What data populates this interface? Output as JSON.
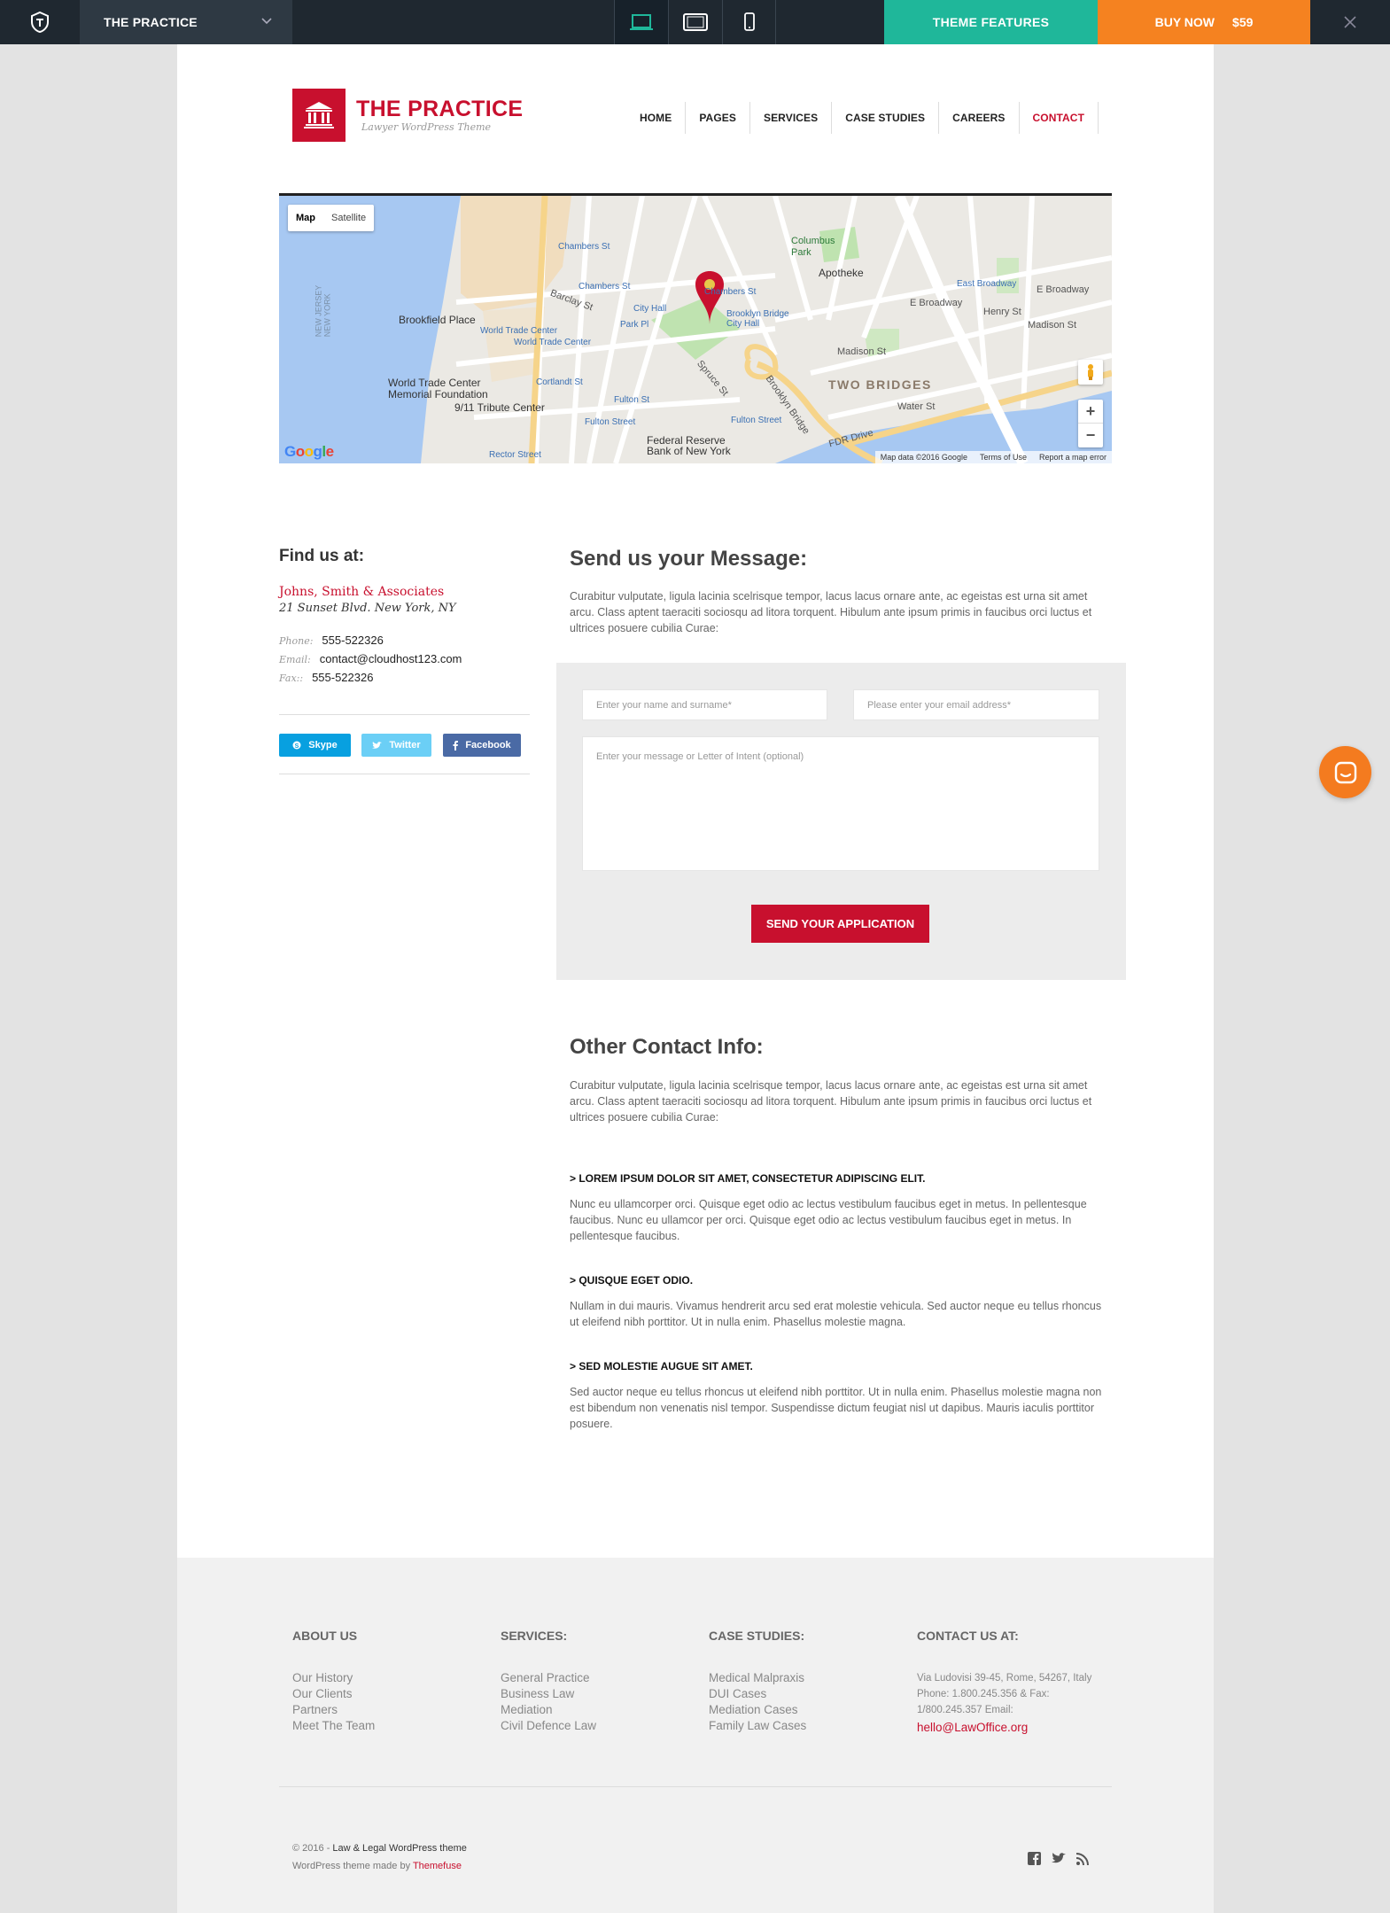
{
  "topbar": {
    "theme_name": "THE PRACTICE",
    "features_label": "THEME FEATURES",
    "buy_label": "BUY NOW",
    "price": "$59",
    "accent_features": "#1fb79a",
    "accent_buy": "#f58220"
  },
  "header": {
    "logo_title": "THE PRACTICE",
    "logo_subtitle": "Lawyer WordPress Theme",
    "nav": [
      {
        "label": "HOME"
      },
      {
        "label": "PAGES"
      },
      {
        "label": "SERVICES"
      },
      {
        "label": "CASE STUDIES"
      },
      {
        "label": "CAREERS"
      },
      {
        "label": "CONTACT",
        "active": true
      }
    ],
    "brand_color": "#c8102e"
  },
  "map": {
    "toggle_map": "Map",
    "toggle_satellite": "Satellite",
    "google": "Google",
    "footer": [
      "Map data ©2016 Google",
      "Terms of Use",
      "Report a map error"
    ],
    "labels": {
      "brookfield": "Brookfield Place",
      "wtc": "World Trade Center",
      "wtc2": "World Trade Center",
      "memorial": "World Trade Center\nMemorial Foundation",
      "tribute": "9/11 Tribute Center",
      "chambers1": "Chambers St",
      "chambers2": "Chambers St",
      "chambers3": "Chambers St",
      "cityhall": "City Hall",
      "parkpl": "Park Pl",
      "bbcityhall": "Brooklyn Bridge\nCity Hall",
      "columbus": "Columbus\nPark",
      "apotheke": "Apotheke",
      "two_bridges": "TWO BRIDGES",
      "east_broadway1": "East Broadway",
      "east_broadway2": "E Broadway",
      "e_broadway3": "E Broadway",
      "madison1": "Madison St",
      "madison2": "Madison St",
      "henry": "Henry St",
      "cortlandt": "Cortlandt St",
      "fulton1": "Fulton St",
      "fulton2": "Fulton Street",
      "fulton3": "Fulton Street",
      "fedres": "Federal Reserve\nBank of New York",
      "fdr": "FDR Drive",
      "bbridge": "Brooklyn Bridge",
      "water": "Water St",
      "rector": "Rector Street",
      "barclay": "Barclay St",
      "spruce": "Spruce St",
      "nj": "NEW JERSEY\nNEW YORK"
    }
  },
  "find_us": {
    "title": "Find us at:",
    "firm": "Johns, Smith & Associates",
    "address": "21 Sunset Blvd. New York, NY",
    "phone_label": "Phone:",
    "phone": "555-522326",
    "email_label": "Email:",
    "email": "contact@cloudhost123.com",
    "fax_label": "Fax::",
    "fax": "555-522326",
    "social": [
      {
        "label": "Skype",
        "icon": "skype-icon"
      },
      {
        "label": "Twitter",
        "icon": "twitter-icon"
      },
      {
        "label": "Facebook",
        "icon": "facebook-icon"
      }
    ]
  },
  "form": {
    "title": "Send us your Message:",
    "text": "Curabitur vulputate, ligula lacinia scelrisque tempor, lacus lacus ornare ante, ac egeistas est urna sit amet arcu. Class aptent taeraciti sociosqu ad litora torquent. Hibulum ante ipsum primis in faucibus orci luctus et ultrices posuere cubilia Curae:",
    "name_placeholder": "Enter your name and surname*",
    "email_placeholder": "Please enter your email address*",
    "message_placeholder": "Enter your message or Letter of Intent (optional)",
    "submit": "SEND YOUR APPLICATION"
  },
  "other": {
    "title": "Other Contact Info:",
    "intro": "Curabitur vulputate, ligula lacinia scelrisque tempor, lacus lacus ornare ante, ac egeistas est urna sit amet arcu. Class aptent taeraciti sociosqu ad litora torquent. Hibulum ante ipsum primis in faucibus orci luctus et ultrices posuere cubilia Curae:",
    "items": [
      {
        "heading": "> LOREM IPSUM DOLOR SIT AMET, CONSECTETUR ADIPISCING ELIT.",
        "text": "Nunc eu ullamcorper orci. Quisque eget odio ac lectus vestibulum faucibus eget in metus. In pellentesque faucibus. Nunc eu ullamcor per orci. Quisque eget odio ac lectus vestibulum faucibus eget in metus. In pellentesque faucibus."
      },
      {
        "heading": "> QUISQUE EGET ODIO.",
        "text": "Nullam in dui mauris. Vivamus hendrerit arcu sed erat molestie vehicula. Sed auctor neque eu tellus rhoncus ut eleifend nibh porttitor. Ut in nulla enim. Phasellus molestie magna."
      },
      {
        "heading": "> SED MOLESTIE AUGUE SIT AMET.",
        "text": "Sed auctor neque eu tellus rhoncus ut eleifend nibh porttitor. Ut in nulla enim. Phasellus molestie magna non est bibendum non venenatis nisl tempor. Suspendisse dictum feugiat nisl ut dapibus. Mauris iaculis porttitor posuere."
      }
    ]
  },
  "footer": {
    "about": {
      "title": "ABOUT US",
      "links": [
        "Our History",
        "Our Clients",
        "Partners",
        "Meet The Team"
      ]
    },
    "services": {
      "title": "SERVICES:",
      "links": [
        "General Practice",
        "Business Law",
        "Mediation",
        "Civil Defence Law"
      ]
    },
    "cases": {
      "title": "CASE STUDIES:",
      "links": [
        "Medical Malpraxis",
        "DUI Cases",
        "Mediation Cases",
        "Family Law Cases"
      ]
    },
    "contact": {
      "title": "CONTACT US AT:",
      "text": "Via Ludovisi 39-45, Rome, 54267, Italy Phone: 1.800.245.356 & Fax: 1/800.245.357 Email:",
      "email": "hello@LawOffice.org"
    },
    "copy_prefix": "© 2016 - ",
    "copy_link": "Law & Legal WordPress theme",
    "made_prefix": "WordPress theme made by ",
    "made_link": "Themefuse"
  }
}
